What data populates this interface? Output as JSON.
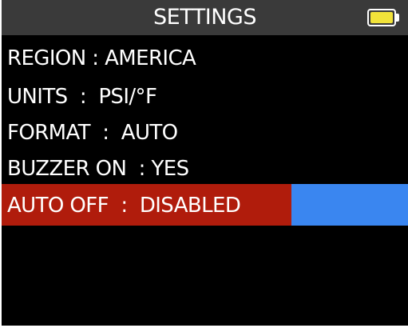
{
  "header": {
    "title": "SETTINGS",
    "battery_icon": "battery-full-icon",
    "battery_color": "#f2e33a"
  },
  "colors": {
    "header_bg": "#3a3a3a",
    "body_bg": "#000000",
    "selected_bg": "#b01c0c",
    "selected_accent": "#3a86f0"
  },
  "menu": {
    "items": [
      {
        "label": "REGION : AMERICA"
      },
      {
        "label": "UNITS  :  PSI/°F"
      },
      {
        "label": "FORMAT  :  AUTO"
      },
      {
        "label": "BUZZER ON  : YES"
      },
      {
        "label": "AUTO OFF  :  DISABLED",
        "selected": true
      }
    ]
  }
}
